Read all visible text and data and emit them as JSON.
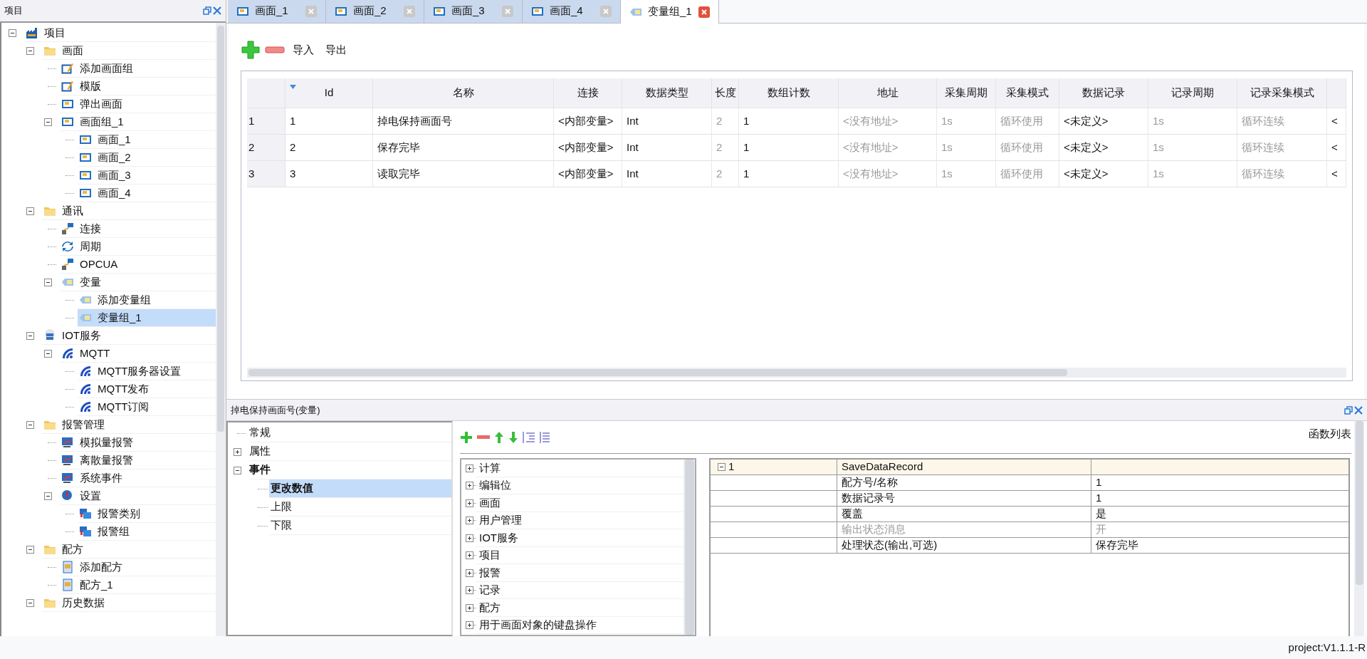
{
  "project_panel": {
    "title": "项目",
    "tree": [
      {
        "label": "项目",
        "kind": "factory",
        "expanded": true,
        "selected": false,
        "children": [
          {
            "label": "画面",
            "kind": "folder",
            "expanded": true,
            "selected": false,
            "children": [
              {
                "label": "添加画面组",
                "kind": "edit",
                "selected": false
              },
              {
                "label": "模版",
                "kind": "edit",
                "selected": false
              },
              {
                "label": "弹出画面",
                "kind": "screen",
                "selected": false
              },
              {
                "label": "画面组_1",
                "kind": "screen",
                "expanded": true,
                "selected": false,
                "children": [
                  {
                    "label": "画面_1",
                    "kind": "screen",
                    "selected": false
                  },
                  {
                    "label": "画面_2",
                    "kind": "screen",
                    "selected": false
                  },
                  {
                    "label": "画面_3",
                    "kind": "screen",
                    "selected": false
                  },
                  {
                    "label": "画面_4",
                    "kind": "screen",
                    "selected": false
                  }
                ]
              }
            ]
          },
          {
            "label": "通讯",
            "kind": "folder",
            "expanded": true,
            "selected": false,
            "children": [
              {
                "label": "连接",
                "kind": "link",
                "selected": false
              },
              {
                "label": "周期",
                "kind": "cycle",
                "selected": false
              },
              {
                "label": "OPCUA",
                "kind": "link",
                "selected": false
              },
              {
                "label": "变量",
                "kind": "tag",
                "expanded": true,
                "selected": false,
                "children": [
                  {
                    "label": "添加变量组",
                    "kind": "tag",
                    "selected": false
                  },
                  {
                    "label": "变量组_1",
                    "kind": "tag",
                    "selected": true
                  }
                ]
              }
            ]
          },
          {
            "label": "IOT服务",
            "kind": "server",
            "expanded": true,
            "selected": false,
            "children": [
              {
                "label": "MQTT",
                "kind": "wifi",
                "expanded": true,
                "selected": false,
                "children": [
                  {
                    "label": "MQTT服务器设置",
                    "kind": "wifi",
                    "selected": false
                  },
                  {
                    "label": "MQTT发布",
                    "kind": "wifi",
                    "selected": false
                  },
                  {
                    "label": "MQTT订阅",
                    "kind": "wifi",
                    "selected": false
                  }
                ]
              }
            ]
          },
          {
            "label": "报警管理",
            "kind": "folder",
            "expanded": true,
            "selected": false,
            "children": [
              {
                "label": "模拟量报警",
                "kind": "monitor",
                "selected": false
              },
              {
                "label": "离散量报警",
                "kind": "monitor",
                "selected": false
              },
              {
                "label": "系统事件",
                "kind": "monitor",
                "selected": false
              },
              {
                "label": "设置",
                "kind": "alert",
                "expanded": true,
                "selected": false,
                "children": [
                  {
                    "label": "报警类别",
                    "kind": "windows",
                    "selected": false
                  },
                  {
                    "label": "报警组",
                    "kind": "windows",
                    "selected": false
                  }
                ]
              }
            ]
          },
          {
            "label": "配方",
            "kind": "folder",
            "expanded": true,
            "selected": false,
            "children": [
              {
                "label": "添加配方",
                "kind": "document",
                "selected": false
              },
              {
                "label": "配方_1",
                "kind": "document",
                "selected": false
              }
            ]
          },
          {
            "label": "历史数据",
            "kind": "folder",
            "expanded": true,
            "selected": false
          }
        ]
      }
    ]
  },
  "tabs": [
    {
      "label": "画面_1",
      "kind": "screen",
      "selected": false
    },
    {
      "label": "画面_2",
      "kind": "screen",
      "selected": false
    },
    {
      "label": "画面_3",
      "kind": "screen",
      "selected": false
    },
    {
      "label": "画面_4",
      "kind": "screen",
      "selected": false
    },
    {
      "label": "变量组_1",
      "kind": "tag",
      "selected": true
    }
  ],
  "toolbar": {
    "buttons": [
      "导入",
      "导出"
    ]
  },
  "table": {
    "columns": [
      {
        "label": "Id",
        "dimmed": false
      },
      {
        "label": "名称",
        "dimmed": false
      },
      {
        "label": "连接",
        "dimmed": false
      },
      {
        "label": "数据类型",
        "dimmed": false
      },
      {
        "label": "长度",
        "dimmed": true
      },
      {
        "label": "数组计数",
        "dimmed": false
      },
      {
        "label": "地址",
        "dimmed": true
      },
      {
        "label": "采集周期",
        "dimmed": true
      },
      {
        "label": "采集模式",
        "dimmed": true
      },
      {
        "label": "数据记录",
        "dimmed": false
      },
      {
        "label": "记录周期",
        "dimmed": true
      },
      {
        "label": "记录采集模式",
        "dimmed": true
      },
      {
        "dimmed": false
      }
    ],
    "rows": [
      {
        "number": "1",
        "cells": [
          "1",
          "掉电保持画面号",
          "<内部变量>",
          "Int",
          "2",
          "1",
          "<没有地址>",
          "1s",
          "循环使用",
          "<未定义>",
          "1s",
          "循环连续",
          "<"
        ]
      },
      {
        "number": "2",
        "cells": [
          "2",
          "保存完毕",
          "<内部变量>",
          "Int",
          "2",
          "1",
          "<没有地址>",
          "1s",
          "循环使用",
          "<未定义>",
          "1s",
          "循环连续",
          "<"
        ]
      },
      {
        "number": "3",
        "cells": [
          "3",
          "读取完毕",
          "<内部变量>",
          "Int",
          "2",
          "1",
          "<没有地址>",
          "1s",
          "循环使用",
          "<未定义>",
          "1s",
          "循环连续",
          "<"
        ]
      }
    ]
  },
  "properties_panel": {
    "title": "掉电保持画面号(变量)",
    "tree": [
      {
        "label": "常规",
        "bold": false,
        "selected": false
      },
      {
        "label": "属性",
        "bold": false,
        "selected": false,
        "expanded": false
      },
      {
        "label": "事件",
        "bold": true,
        "selected": false,
        "expanded": true,
        "children": [
          {
            "label": "更改数值",
            "bold": true,
            "selected": true
          },
          {
            "label": "上限",
            "bold": false,
            "selected": false
          },
          {
            "label": "下限",
            "bold": false,
            "selected": false
          }
        ]
      }
    ],
    "function_list": [
      {
        "label": "计算",
        "expanded": false
      },
      {
        "label": "编辑位",
        "expanded": false
      },
      {
        "label": "画面",
        "expanded": false
      },
      {
        "label": "用户管理",
        "expanded": false
      },
      {
        "label": "IOT服务",
        "expanded": false
      },
      {
        "label": "项目",
        "expanded": false
      },
      {
        "label": "报警",
        "expanded": false
      },
      {
        "label": "记录",
        "expanded": false
      },
      {
        "label": "配方",
        "expanded": false
      },
      {
        "label": "用于画面对象的键盘操作",
        "expanded": false
      }
    ],
    "function_list_label": "函数列表",
    "functions": [
      {
        "index": "1",
        "name": "SaveDataRecord",
        "expanded": true,
        "params": [
          {
            "name": "配方号/名称",
            "value": "1",
            "disabled": false
          },
          {
            "name": "数据记录号",
            "value": "1",
            "disabled": false
          },
          {
            "name": "覆盖",
            "value": "是",
            "disabled": false
          },
          {
            "name": "输出状态消息",
            "value": "开",
            "disabled": true
          },
          {
            "name": "处理状态(输出,可选)",
            "value": "保存完毕",
            "disabled": false
          }
        ]
      }
    ]
  },
  "status_bar": {
    "text": "project:V1.1.1-R"
  }
}
